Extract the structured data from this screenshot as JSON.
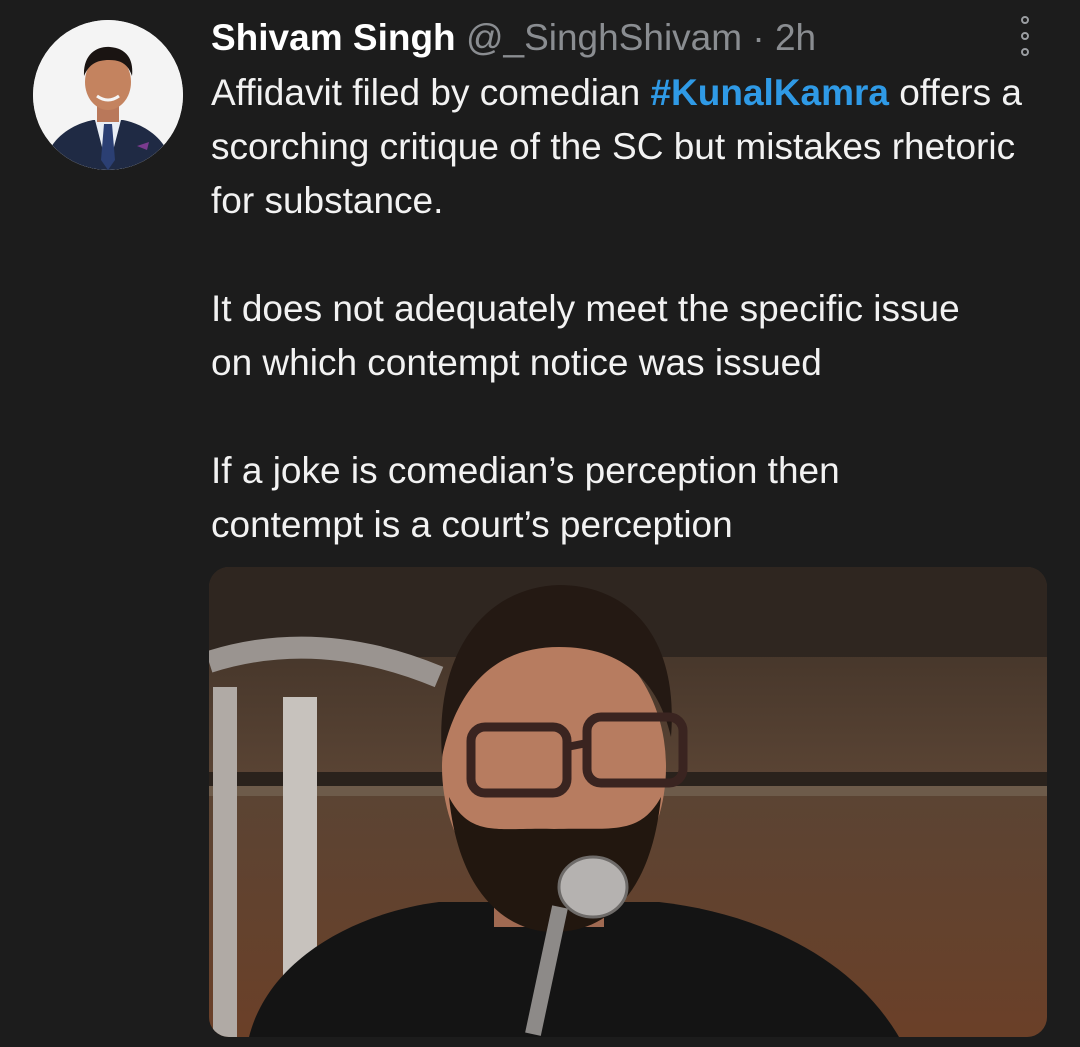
{
  "tweet": {
    "display_name": "Shivam Singh",
    "handle": "@_SinghShivam",
    "separator": "·",
    "time": "2h",
    "text": {
      "p1_before": "Affidavit filed by comedian ",
      "hashtag": "#KunalKamra",
      "p1_after": " offers a scorching critique of the SC but mistakes rhetoric for substance.",
      "p2_line1": "It does not adequately meet the specific issue",
      "p2_line2": "on which contempt notice was issued",
      "p3_line1": "If a joke is comedian’s perception then",
      "p3_line2": "contempt is a court’s perception"
    },
    "avatar_icon": "profile-photo",
    "more_icon": "more-options-icon"
  },
  "colors": {
    "background": "#1c1c1c",
    "text": "#f2f2f2",
    "secondary_text": "#8a8d91",
    "hashtag": "#2f9ae6"
  }
}
